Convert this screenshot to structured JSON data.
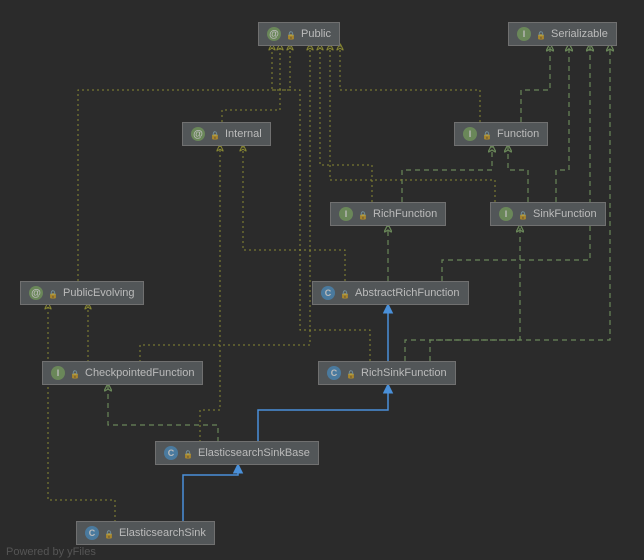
{
  "nodes": {
    "public": {
      "label": "Public",
      "type": "annotation"
    },
    "serializable": {
      "label": "Serializable",
      "type": "interface"
    },
    "internal": {
      "label": "Internal",
      "type": "annotation"
    },
    "function": {
      "label": "Function",
      "type": "interface"
    },
    "richfunction": {
      "label": "RichFunction",
      "type": "interface"
    },
    "sinkfunction": {
      "label": "SinkFunction",
      "type": "interface"
    },
    "publicevolving": {
      "label": "PublicEvolving",
      "type": "annotation"
    },
    "abstractrichfunction": {
      "label": "AbstractRichFunction",
      "type": "class"
    },
    "checkpointedfunction": {
      "label": "CheckpointedFunction",
      "type": "interface"
    },
    "richsinkfunction": {
      "label": "RichSinkFunction",
      "type": "class"
    },
    "elasticsearchsinkbase": {
      "label": "ElasticsearchSinkBase",
      "type": "class"
    },
    "elasticsearchsink": {
      "label": "ElasticsearchSink",
      "type": "class"
    }
  },
  "footer": "Powered by yFiles",
  "edges": [
    {
      "from": "elasticsearchsink",
      "to": "elasticsearchsinkbase",
      "style": "solid-blue"
    },
    {
      "from": "elasticsearchsinkbase",
      "to": "richsinkfunction",
      "style": "solid-blue"
    },
    {
      "from": "richsinkfunction",
      "to": "abstractrichfunction",
      "style": "solid-blue"
    },
    {
      "from": "elasticsearchsinkbase",
      "to": "checkpointedfunction",
      "style": "dashed-green"
    },
    {
      "from": "checkpointedfunction",
      "to": "publicevolving",
      "style": "dotted-olive"
    },
    {
      "from": "richsinkfunction",
      "to": "sinkfunction",
      "style": "dashed-green"
    },
    {
      "from": "abstractrichfunction",
      "to": "richfunction",
      "style": "dashed-green"
    },
    {
      "from": "richfunction",
      "to": "function",
      "style": "dashed-green"
    },
    {
      "from": "sinkfunction",
      "to": "function",
      "style": "dashed-green"
    },
    {
      "from": "sinkfunction",
      "to": "serializable",
      "style": "dashed-green"
    },
    {
      "from": "function",
      "to": "serializable",
      "style": "dashed-green"
    },
    {
      "from": "abstractrichfunction",
      "to": "serializable",
      "style": "dashed-green"
    },
    {
      "from": "richsinkfunction",
      "to": "serializable",
      "style": "dashed-green"
    },
    {
      "from": "elasticsearchsink",
      "to": "publicevolving",
      "style": "dotted-olive"
    },
    {
      "from": "elasticsearchsinkbase",
      "to": "internal",
      "style": "dotted-olive"
    },
    {
      "from": "richsinkfunction",
      "to": "public",
      "style": "dotted-olive"
    },
    {
      "from": "sinkfunction",
      "to": "public",
      "style": "dotted-olive"
    },
    {
      "from": "richfunction",
      "to": "public",
      "style": "dotted-olive"
    },
    {
      "from": "function",
      "to": "public",
      "style": "dotted-olive"
    },
    {
      "from": "publicevolving",
      "to": "public",
      "style": "dotted-olive"
    },
    {
      "from": "internal",
      "to": "public",
      "style": "dotted-olive"
    },
    {
      "from": "abstractrichfunction",
      "to": "internal",
      "style": "dotted-olive"
    },
    {
      "from": "checkpointedfunction",
      "to": "public",
      "style": "dotted-olive"
    }
  ],
  "colors": {
    "bg": "#2b2b2b",
    "nodeBg": "#525658",
    "nodeBorder": "#707070",
    "text": "#bbbbbb",
    "blue": "#4a90d9",
    "green": "#6a8759",
    "olive": "#808000"
  }
}
